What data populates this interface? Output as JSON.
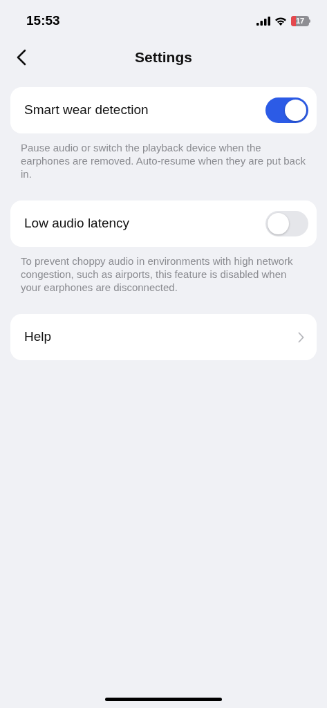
{
  "status_bar": {
    "time": "15:53",
    "battery": "17",
    "battery_low": true
  },
  "nav": {
    "title": "Settings"
  },
  "sections": [
    {
      "kind": "toggle",
      "label": "Smart wear detection",
      "on": true,
      "description": "Pause audio or switch the playback device when the earphones are removed. Auto-resume when they are put back in."
    },
    {
      "kind": "toggle",
      "label": "Low audio latency",
      "on": false,
      "description": "To prevent choppy audio in environments with high network congestion, such as airports, this feature is disabled when your earphones are disconnected."
    },
    {
      "kind": "link",
      "label": "Help"
    }
  ]
}
